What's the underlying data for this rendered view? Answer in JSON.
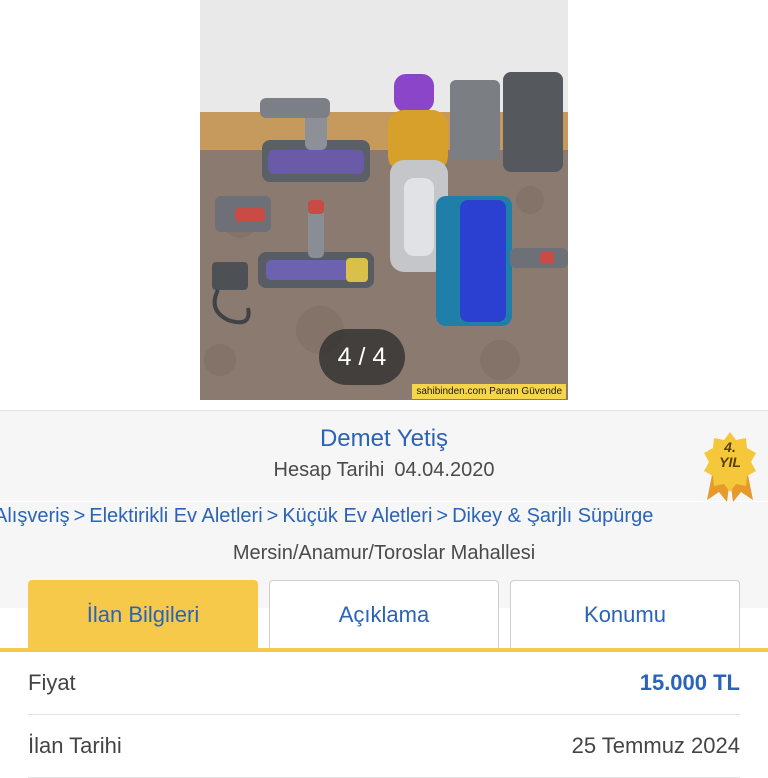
{
  "gallery": {
    "counter": "4 / 4",
    "watermark": "sahibinden.com Param Güvende"
  },
  "seller": {
    "name": "Demet Yetiş",
    "since_label": "Hesap Tarihi",
    "since_date": "04.04.2020",
    "badge_num": "4.",
    "badge_word": "YIL"
  },
  "breadcrumb": {
    "items": [
      "Alışveriş",
      "Elektirikli Ev Aletleri",
      "Küçük Ev Aletleri",
      "Dikey & Şarjlı Süpürge"
    ],
    "separator": ">"
  },
  "location": "Mersin/Anamur/Toroslar Mahallesi",
  "tabs": [
    {
      "label": "İlan Bilgileri",
      "active": true
    },
    {
      "label": "Açıklama",
      "active": false
    },
    {
      "label": "Konumu",
      "active": false
    }
  ],
  "details": [
    {
      "label": "Fiyat",
      "value": "15.000 TL"
    },
    {
      "label": "İlan Tarihi",
      "value": "25 Temmuz 2024"
    }
  ],
  "colors": {
    "accent": "#f7c94a",
    "link": "#2a63b8",
    "background": "#f6f6f6"
  }
}
